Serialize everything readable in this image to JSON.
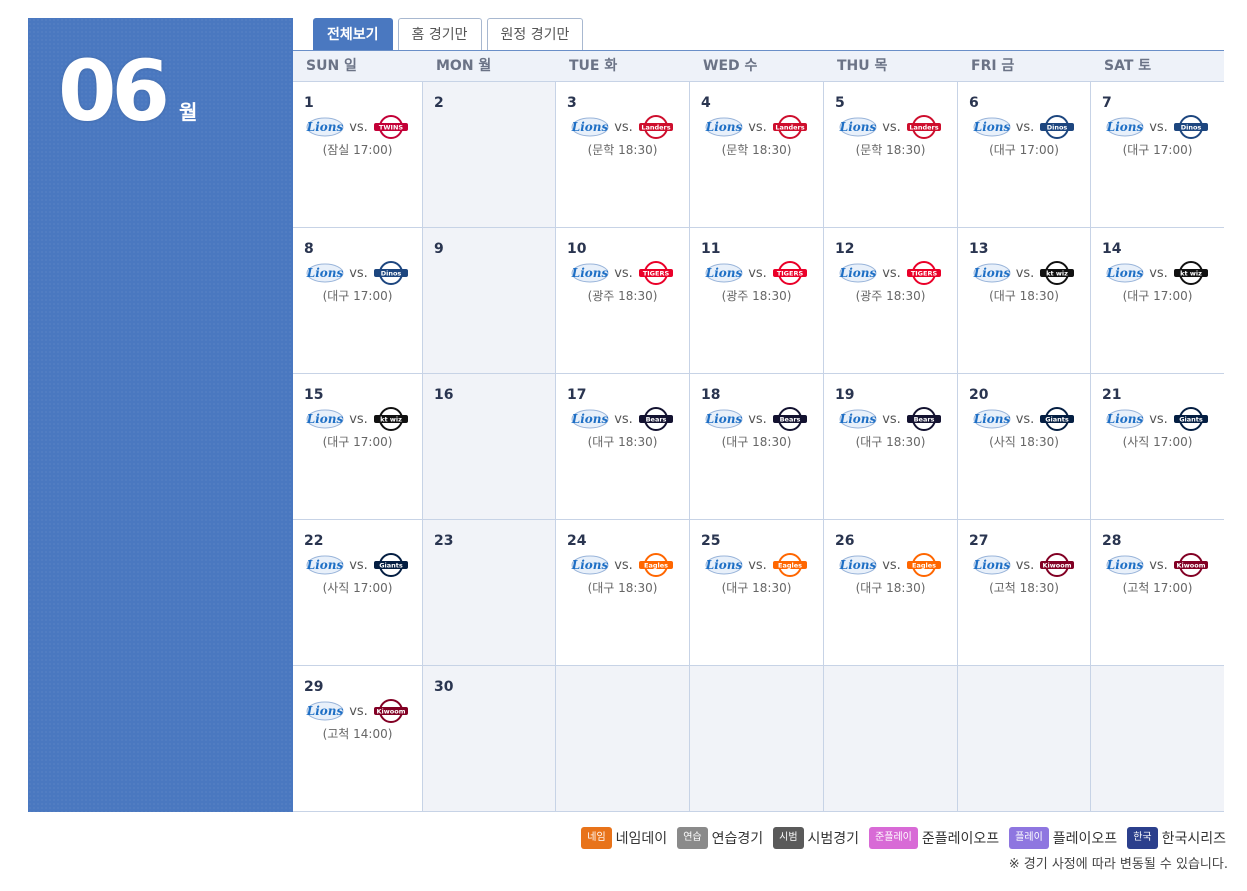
{
  "month": {
    "number": "06",
    "unit": "월"
  },
  "tabs": [
    {
      "label": "전체보기",
      "active": true
    },
    {
      "label": "홈 경기만",
      "active": false
    },
    {
      "label": "원정 경기만",
      "active": false
    }
  ],
  "weekdays": [
    "SUN 일",
    "MON 월",
    "TUE 화",
    "WED 수",
    "THU 목",
    "FRI 금",
    "SAT 토"
  ],
  "team_colors": {
    "lions": "#1e6fc5",
    "twins": "#c30037",
    "landers": "#ce0e2d",
    "dinos": "#1d467f",
    "tigers": "#ea0029",
    "ktwiz": "#111111",
    "bears": "#131230",
    "giants": "#041e42",
    "eagles": "#ff6600",
    "heroes": "#820024"
  },
  "weeks": [
    [
      {
        "day": "1",
        "game": {
          "home": "lions",
          "opponent": "twins",
          "opponent_label": "TWINS",
          "vs": "vs.",
          "info": "(잠실 17:00)"
        }
      },
      {
        "day": "2",
        "off": true
      },
      {
        "day": "3",
        "game": {
          "home": "lions",
          "opponent": "landers",
          "opponent_label": "Landers",
          "vs": "vs.",
          "info": "(문학 18:30)"
        }
      },
      {
        "day": "4",
        "game": {
          "home": "lions",
          "opponent": "landers",
          "opponent_label": "Landers",
          "vs": "vs.",
          "info": "(문학 18:30)"
        }
      },
      {
        "day": "5",
        "game": {
          "home": "lions",
          "opponent": "landers",
          "opponent_label": "Landers",
          "vs": "vs.",
          "info": "(문학 18:30)"
        }
      },
      {
        "day": "6",
        "game": {
          "home": "lions",
          "opponent": "dinos",
          "opponent_label": "Dinos",
          "vs": "vs.",
          "info": "(대구 17:00)"
        }
      },
      {
        "day": "7",
        "game": {
          "home": "lions",
          "opponent": "dinos",
          "opponent_label": "Dinos",
          "vs": "vs.",
          "info": "(대구 17:00)"
        }
      }
    ],
    [
      {
        "day": "8",
        "game": {
          "home": "lions",
          "opponent": "dinos",
          "opponent_label": "Dinos",
          "vs": "vs.",
          "info": "(대구 17:00)"
        }
      },
      {
        "day": "9",
        "off": true
      },
      {
        "day": "10",
        "game": {
          "home": "lions",
          "opponent": "tigers",
          "opponent_label": "TIGERS",
          "vs": "vs.",
          "info": "(광주 18:30)"
        }
      },
      {
        "day": "11",
        "game": {
          "home": "lions",
          "opponent": "tigers",
          "opponent_label": "TIGERS",
          "vs": "vs.",
          "info": "(광주 18:30)"
        }
      },
      {
        "day": "12",
        "game": {
          "home": "lions",
          "opponent": "tigers",
          "opponent_label": "TIGERS",
          "vs": "vs.",
          "info": "(광주 18:30)"
        }
      },
      {
        "day": "13",
        "game": {
          "home": "lions",
          "opponent": "ktwiz",
          "opponent_label": "kt wiz",
          "vs": "vs.",
          "info": "(대구 18:30)"
        }
      },
      {
        "day": "14",
        "game": {
          "home": "lions",
          "opponent": "ktwiz",
          "opponent_label": "kt wiz",
          "vs": "vs.",
          "info": "(대구 17:00)"
        }
      }
    ],
    [
      {
        "day": "15",
        "game": {
          "home": "lions",
          "opponent": "ktwiz",
          "opponent_label": "kt wiz",
          "vs": "vs.",
          "info": "(대구 17:00)"
        }
      },
      {
        "day": "16",
        "off": true
      },
      {
        "day": "17",
        "game": {
          "home": "lions",
          "opponent": "bears",
          "opponent_label": "Bears",
          "vs": "vs.",
          "info": "(대구 18:30)"
        }
      },
      {
        "day": "18",
        "game": {
          "home": "lions",
          "opponent": "bears",
          "opponent_label": "Bears",
          "vs": "vs.",
          "info": "(대구 18:30)"
        }
      },
      {
        "day": "19",
        "game": {
          "home": "lions",
          "opponent": "bears",
          "opponent_label": "Bears",
          "vs": "vs.",
          "info": "(대구 18:30)"
        }
      },
      {
        "day": "20",
        "game": {
          "home": "lions",
          "opponent": "giants",
          "opponent_label": "Giants",
          "vs": "vs.",
          "info": "(사직 18:30)"
        }
      },
      {
        "day": "21",
        "game": {
          "home": "lions",
          "opponent": "giants",
          "opponent_label": "Giants",
          "vs": "vs.",
          "info": "(사직 17:00)"
        }
      }
    ],
    [
      {
        "day": "22",
        "game": {
          "home": "lions",
          "opponent": "giants",
          "opponent_label": "Giants",
          "vs": "vs.",
          "info": "(사직 17:00)"
        }
      },
      {
        "day": "23",
        "off": true
      },
      {
        "day": "24",
        "game": {
          "home": "lions",
          "opponent": "eagles",
          "opponent_label": "Eagles",
          "vs": "vs.",
          "info": "(대구 18:30)"
        }
      },
      {
        "day": "25",
        "game": {
          "home": "lions",
          "opponent": "eagles",
          "opponent_label": "Eagles",
          "vs": "vs.",
          "info": "(대구 18:30)"
        }
      },
      {
        "day": "26",
        "game": {
          "home": "lions",
          "opponent": "eagles",
          "opponent_label": "Eagles",
          "vs": "vs.",
          "info": "(대구 18:30)"
        }
      },
      {
        "day": "27",
        "game": {
          "home": "lions",
          "opponent": "heroes",
          "opponent_label": "Kiwoom",
          "vs": "vs.",
          "info": "(고척 18:30)"
        }
      },
      {
        "day": "28",
        "game": {
          "home": "lions",
          "opponent": "heroes",
          "opponent_label": "Kiwoom",
          "vs": "vs.",
          "info": "(고척 17:00)"
        }
      }
    ],
    [
      {
        "day": "29",
        "game": {
          "home": "lions",
          "opponent": "heroes",
          "opponent_label": "Kiwoom",
          "vs": "vs.",
          "info": "(고척 14:00)"
        }
      },
      {
        "day": "30",
        "off": true
      },
      {
        "day": "",
        "off": true
      },
      {
        "day": "",
        "off": true
      },
      {
        "day": "",
        "off": true
      },
      {
        "day": "",
        "off": true
      },
      {
        "day": "",
        "off": true
      }
    ]
  ],
  "home_logo_label": "Lions",
  "legend": [
    {
      "badge": "네임",
      "label": "네임데이",
      "color": "#e8731a"
    },
    {
      "badge": "연습",
      "label": "연습경기",
      "color": "#8a8a8a"
    },
    {
      "badge": "시범",
      "label": "시범경기",
      "color": "#5a5a5a"
    },
    {
      "badge": "준플레이",
      "label": "준플레이오프",
      "color": "#d86ad6"
    },
    {
      "badge": "플레이",
      "label": "플레이오프",
      "color": "#8e76e0"
    },
    {
      "badge": "한국",
      "label": "한국시리즈",
      "color": "#2b3f8c"
    }
  ],
  "note": "※ 경기 사정에 따라 변동될 수 있습니다."
}
